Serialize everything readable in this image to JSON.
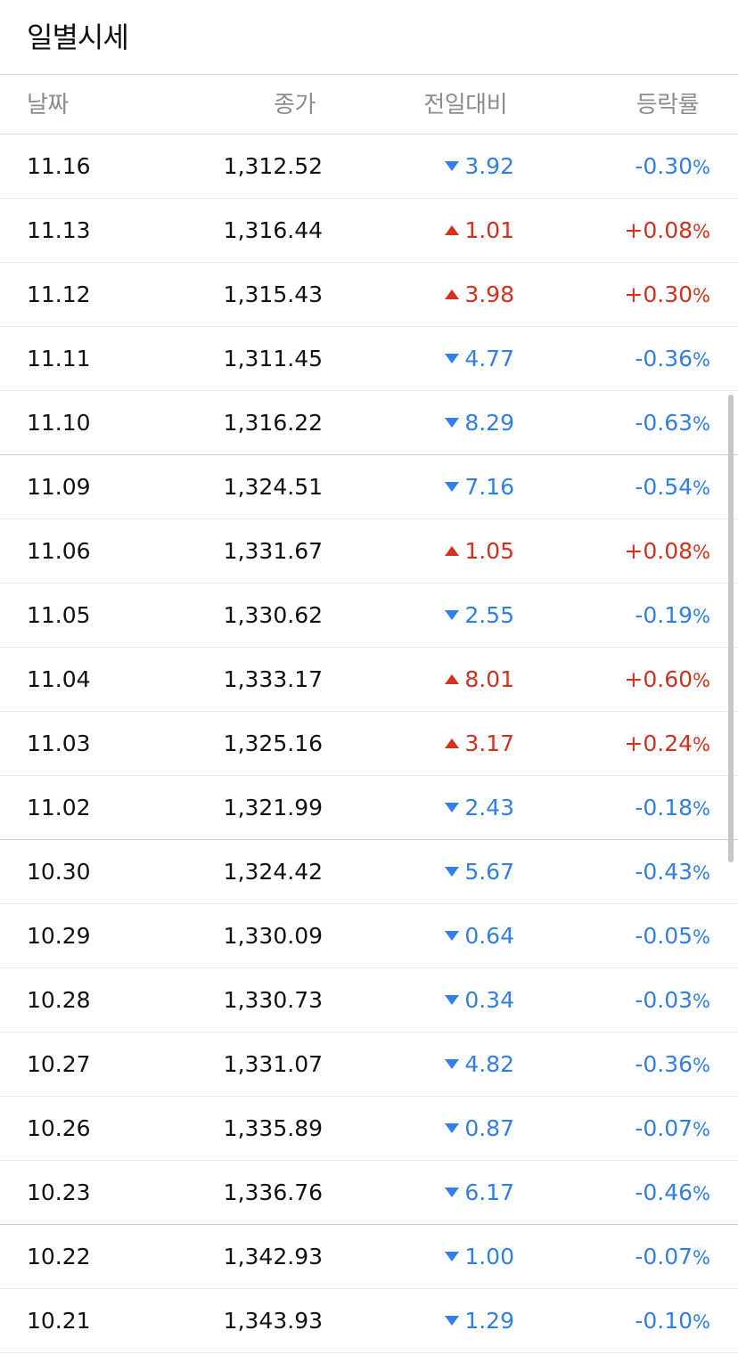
{
  "header": {
    "title": "일별시세"
  },
  "columns": {
    "date": "날짜",
    "close": "종가",
    "change": "전일대비",
    "rate": "등락률"
  },
  "rows": [
    {
      "date": "11.16",
      "close": "1,312.52",
      "direction": "down",
      "change": "3.92",
      "rate": "-0.30",
      "pct": "%"
    },
    {
      "date": "11.13",
      "close": "1,316.44",
      "direction": "up",
      "change": "1.01",
      "rate": "+0.08",
      "pct": "%"
    },
    {
      "date": "11.12",
      "close": "1,315.43",
      "direction": "up",
      "change": "3.98",
      "rate": "+0.30",
      "pct": "%"
    },
    {
      "date": "11.11",
      "close": "1,311.45",
      "direction": "down",
      "change": "4.77",
      "rate": "-0.36",
      "pct": "%"
    },
    {
      "date": "11.10",
      "close": "1,316.22",
      "direction": "down",
      "change": "8.29",
      "rate": "-0.63",
      "pct": "%"
    },
    {
      "date": "11.09",
      "close": "1,324.51",
      "direction": "down",
      "change": "7.16",
      "rate": "-0.54",
      "pct": "%"
    },
    {
      "date": "11.06",
      "close": "1,331.67",
      "direction": "up",
      "change": "1.05",
      "rate": "+0.08",
      "pct": "%"
    },
    {
      "date": "11.05",
      "close": "1,330.62",
      "direction": "down",
      "change": "2.55",
      "rate": "-0.19",
      "pct": "%"
    },
    {
      "date": "11.04",
      "close": "1,333.17",
      "direction": "up",
      "change": "8.01",
      "rate": "+0.60",
      "pct": "%"
    },
    {
      "date": "11.03",
      "close": "1,325.16",
      "direction": "up",
      "change": "3.17",
      "rate": "+0.24",
      "pct": "%"
    },
    {
      "date": "11.02",
      "close": "1,321.99",
      "direction": "down",
      "change": "2.43",
      "rate": "-0.18",
      "pct": "%"
    },
    {
      "date": "10.30",
      "close": "1,324.42",
      "direction": "down",
      "change": "5.67",
      "rate": "-0.43",
      "pct": "%"
    },
    {
      "date": "10.29",
      "close": "1,330.09",
      "direction": "down",
      "change": "0.64",
      "rate": "-0.05",
      "pct": "%"
    },
    {
      "date": "10.28",
      "close": "1,330.73",
      "direction": "down",
      "change": "0.34",
      "rate": "-0.03",
      "pct": "%"
    },
    {
      "date": "10.27",
      "close": "1,331.07",
      "direction": "down",
      "change": "4.82",
      "rate": "-0.36",
      "pct": "%"
    },
    {
      "date": "10.26",
      "close": "1,335.89",
      "direction": "down",
      "change": "0.87",
      "rate": "-0.07",
      "pct": "%"
    },
    {
      "date": "10.23",
      "close": "1,336.76",
      "direction": "down",
      "change": "6.17",
      "rate": "-0.46",
      "pct": "%"
    },
    {
      "date": "10.22",
      "close": "1,342.93",
      "direction": "down",
      "change": "1.00",
      "rate": "-0.07",
      "pct": "%"
    },
    {
      "date": "10.21",
      "close": "1,343.93",
      "direction": "down",
      "change": "1.29",
      "rate": "-0.10",
      "pct": "%"
    }
  ],
  "colors": {
    "up": "#d2321e",
    "down": "#2f7fe8"
  },
  "icons": {
    "up": "triangle-up-icon",
    "down": "triangle-down-icon"
  }
}
